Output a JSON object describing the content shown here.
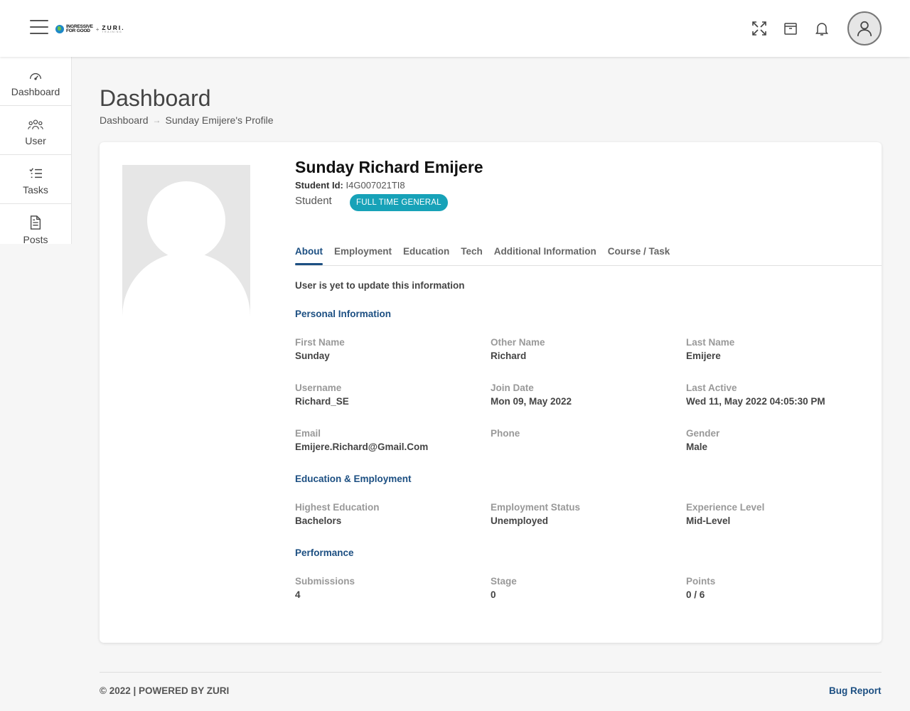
{
  "header": {
    "logo": {
      "part1_line1": "INGRESSIVE",
      "part1_line2": "FOR GOOD",
      "plus": "+",
      "part2": "ZURI.",
      "part2_sub": "TRAINING"
    },
    "icons": [
      "fullscreen-icon",
      "archive-icon",
      "bell-icon",
      "user-avatar-icon"
    ]
  },
  "sidebar": {
    "items": [
      {
        "label": "Dashboard",
        "icon": "speedometer-icon"
      },
      {
        "label": "User",
        "icon": "users-icon"
      },
      {
        "label": "Tasks",
        "icon": "checklist-icon"
      },
      {
        "label": "Posts",
        "icon": "document-icon"
      }
    ]
  },
  "page": {
    "title": "Dashboard",
    "breadcrumb": [
      "Dashboard",
      "Sunday Emijere's Profile"
    ]
  },
  "profile": {
    "name": "Sunday Richard Emijere",
    "student_id_label": "Student Id:",
    "student_id": "I4G007021TI8",
    "role": "Student",
    "badge": "FULL TIME GENERAL",
    "tabs": [
      "About",
      "Employment",
      "Education",
      "Tech",
      "Additional Information",
      "Course / Task"
    ],
    "active_tab": "About",
    "notice": "User is yet to update this information",
    "personal": {
      "title": "Personal Information",
      "first_name_label": "First Name",
      "first_name": "Sunday",
      "other_name_label": "Other Name",
      "other_name": "Richard",
      "last_name_label": "Last Name",
      "last_name": "Emijere",
      "username_label": "Username",
      "username": "Richard_SE",
      "join_date_label": "Join Date",
      "join_date": "Mon 09, May 2022",
      "last_active_label": "Last Active",
      "last_active": "Wed 11, May 2022 04:05:30 PM",
      "email_label": "Email",
      "email": "Emijere.Richard@Gmail.Com",
      "phone_label": "Phone",
      "phone": "",
      "gender_label": "Gender",
      "gender": "Male"
    },
    "education": {
      "title": "Education & Employment",
      "highest_label": "Highest Education",
      "highest": "Bachelors",
      "employment_label": "Employment Status",
      "employment": "Unemployed",
      "experience_label": "Experience Level",
      "experience": "Mid-Level"
    },
    "performance": {
      "title": "Performance",
      "submissions_label": "Submissions",
      "submissions": "4",
      "stage_label": "Stage",
      "stage": "0",
      "points_label": "Points",
      "points": "0 / 6"
    }
  },
  "footer": {
    "left": "© 2022 | POWERED BY ZURI",
    "right": "Bug Report"
  },
  "colors": {
    "accent": "#1c4f82",
    "badge": "#17a2b8",
    "background": "#f6f6f6"
  }
}
